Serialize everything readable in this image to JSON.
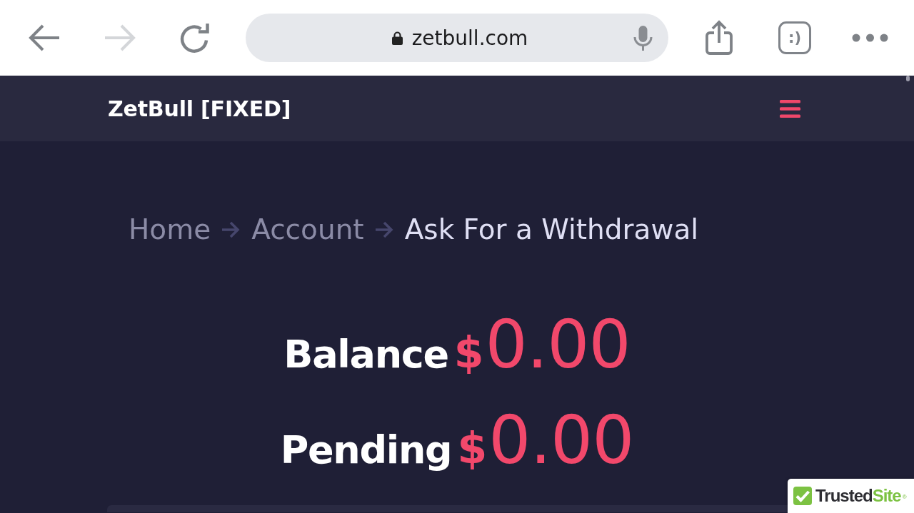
{
  "browser": {
    "nav_buttons": [
      {
        "kind": "back",
        "disabled": false
      },
      {
        "kind": "forward",
        "disabled": true
      },
      {
        "kind": "reload",
        "disabled": false
      }
    ],
    "secure": true,
    "address": "zetbull.com",
    "tab_count": ":)"
  },
  "site_header": {
    "title": "ZetBull [FIXED]"
  },
  "breadcrumb": [
    {
      "label": "Home",
      "current": false
    },
    {
      "label": "Account",
      "current": false
    },
    {
      "label": "Ask For a Withdrawal",
      "current": true
    }
  ],
  "balances": [
    {
      "label": "Balance",
      "currency": "$",
      "amount": "0.00"
    },
    {
      "label": "Pending",
      "currency": "$",
      "amount": "0.00"
    }
  ],
  "trust_badge": {
    "name_start": "Trusted",
    "name_end": "Site",
    "registered_mark": "®"
  }
}
